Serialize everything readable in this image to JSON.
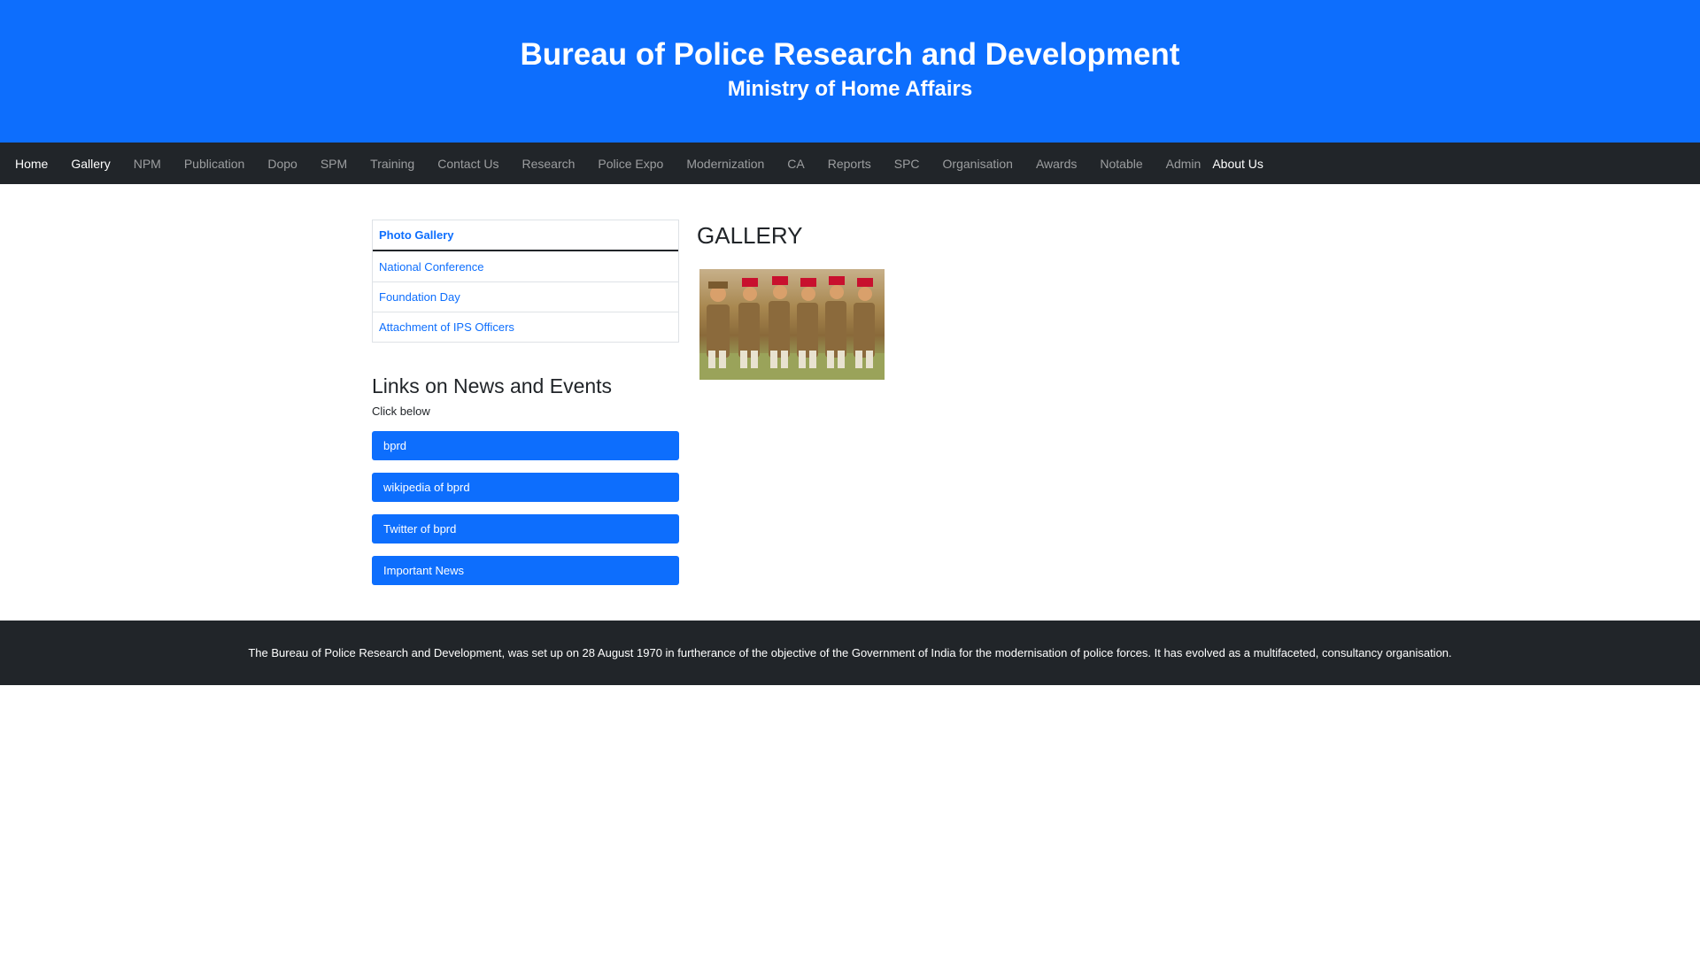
{
  "header": {
    "title": "Bureau of Police Research and Development",
    "subtitle": "Ministry of Home Affairs"
  },
  "nav": {
    "items": [
      {
        "label": "Home",
        "active": true
      },
      {
        "label": "Gallery",
        "active": true
      },
      {
        "label": "NPM"
      },
      {
        "label": "Publication"
      },
      {
        "label": "Dopo"
      },
      {
        "label": "SPM"
      },
      {
        "label": "Training"
      },
      {
        "label": "Contact Us"
      },
      {
        "label": "Research"
      },
      {
        "label": "Police Expo"
      },
      {
        "label": "Modernization"
      },
      {
        "label": "CA"
      },
      {
        "label": "Reports"
      },
      {
        "label": "SPC"
      },
      {
        "label": "Organisation"
      },
      {
        "label": "Awards"
      },
      {
        "label": "Notable"
      },
      {
        "label": "Admin"
      },
      {
        "label": "About Us",
        "active": true
      }
    ]
  },
  "sidebar": {
    "gallery_list": [
      {
        "label": "Photo Gallery"
      },
      {
        "label": "National Conference"
      },
      {
        "label": "Foundation Day"
      },
      {
        "label": "Attachment of IPS Officers"
      }
    ],
    "links_heading": "Links on News and Events",
    "links_sub": "Click below",
    "links": [
      {
        "label": "bprd"
      },
      {
        "label": "wikipedia of bprd"
      },
      {
        "label": "Twitter of bprd"
      },
      {
        "label": "Important News"
      }
    ]
  },
  "main": {
    "gallery_title": "GALLERY"
  },
  "footer": {
    "text": "The Bureau of Police Research and Development, was set up on 28 August 1970 in furtherance of the objective of the Government of India for the modernisation of police forces. It has evolved as a multifaceted, consultancy organisation."
  },
  "colors": {
    "primary": "#0d6efd",
    "dark": "#212529"
  }
}
